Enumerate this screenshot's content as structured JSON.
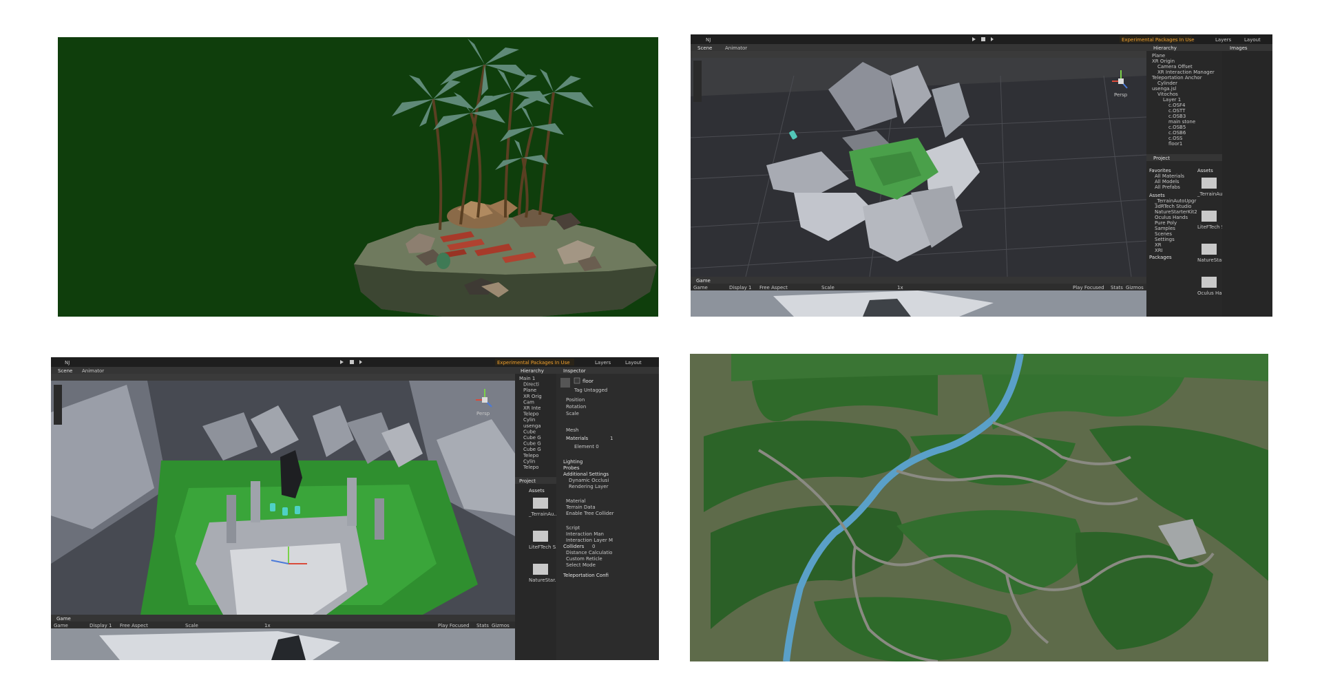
{
  "scene_view": {
    "toolbar": {
      "account": "NJ",
      "warning": "Experimental Packages In Use",
      "layers_label": "Layers",
      "layout_label": "Layout"
    },
    "tabs": {
      "scene": "Scene",
      "animator": "Animator",
      "game": "Game"
    },
    "game_bar": {
      "game": "Game",
      "display": "Display 1",
      "aspect": "Free Aspect",
      "scale_label": "Scale",
      "scale_value": "1x",
      "play_focused": "Play Focused",
      "stats": "Stats",
      "gizmos": "Gizmos"
    },
    "gizmo_label": "Persp",
    "hierarchy": {
      "title": "Hierarchy",
      "items": [
        "Plane",
        "XR Origin",
        "Camera Offset",
        "XR Interaction Manager",
        "Teleportation Anchor",
        "Cylinder",
        "usenga.jsl",
        "Vitochos",
        "Layer 1",
        "c.OSF4",
        "c.OSTT",
        "c.OSB3",
        "main stone",
        "c.OSB5",
        "c.OSB6",
        "c.OSS",
        "floor1"
      ]
    },
    "project": {
      "title": "Project",
      "favorites": "Favorites",
      "favorite_items": [
        "All Materials",
        "All Models",
        "All Prefabs"
      ],
      "assets_root": "Assets",
      "asset_folders": [
        "_TerrainAutoUpgr",
        "3dRTech Studio",
        "NatureStarterKit2",
        "Oculus Hands",
        "Pure Poly",
        "Samples",
        "Scenes",
        "Settings",
        "XR",
        "XRI"
      ],
      "packages": "Packages",
      "assets_title": "Assets",
      "grid_labels": [
        "_TerrainAu...",
        "LiteFTech S...",
        "NatureStar...",
        "Oculus Ha..."
      ]
    },
    "images_label": "Images"
  },
  "inspector_view": {
    "toolbar": {
      "account": "NJ",
      "warning": "Experimental Packages In Use",
      "layers_label": "Layers",
      "layout_label": "Layout"
    },
    "tabs": {
      "scene": "Scene",
      "animator": "Animator",
      "game": "Game"
    },
    "game_bar": {
      "game": "Game",
      "display": "Display 1",
      "aspect": "Free Aspect",
      "scale_label": "Scale",
      "scale_value": "1x",
      "play_focused": "Play Focused",
      "stats": "Stats",
      "gizmos": "Gizmos"
    },
    "gizmo_label": "Persp",
    "hierarchy": {
      "title": "Hierarchy",
      "items": [
        "Main 1",
        "Directi",
        "Plane",
        "XR Orig",
        "Cam",
        "XR Inte",
        "Telepo",
        "Cylin",
        "usenga",
        "Cube",
        "Cube G",
        "Cube G",
        "Cube G",
        "Telepo",
        "Cylin",
        "Telepo"
      ]
    },
    "project": {
      "title": "Project",
      "assets_title": "Assets",
      "grid_labels": [
        "_TerrainAu...",
        "LiteFTech S...",
        "NatureStar..."
      ]
    },
    "inspector": {
      "title": "Inspector",
      "object_name": "floor",
      "tag_label": "Tag",
      "tag_value": "Untagged",
      "transform_rows": [
        "Position",
        "Rotation",
        "Scale"
      ],
      "mesh_label": "Mesh",
      "materials_label": "Materials",
      "materials_count": "1",
      "element_label": "Element 0",
      "sections": [
        "Lighting",
        "Probes",
        "Additional Settings"
      ],
      "additional_rows": [
        "Dynamic Occlusi",
        "Rendering Layer"
      ],
      "terrain_rows": [
        "Material",
        "Terrain Data",
        "Enable Tree Collider"
      ],
      "script_rows": [
        "Script",
        "Interaction Man",
        "Interaction Layer M"
      ],
      "colliders_label": "Colliders",
      "colliders_count": "0",
      "collider_rows": [
        "Distance Calculatio",
        "Custom Reticle",
        "Select Mode"
      ],
      "teleport_row": "Teleportation Confi"
    }
  }
}
